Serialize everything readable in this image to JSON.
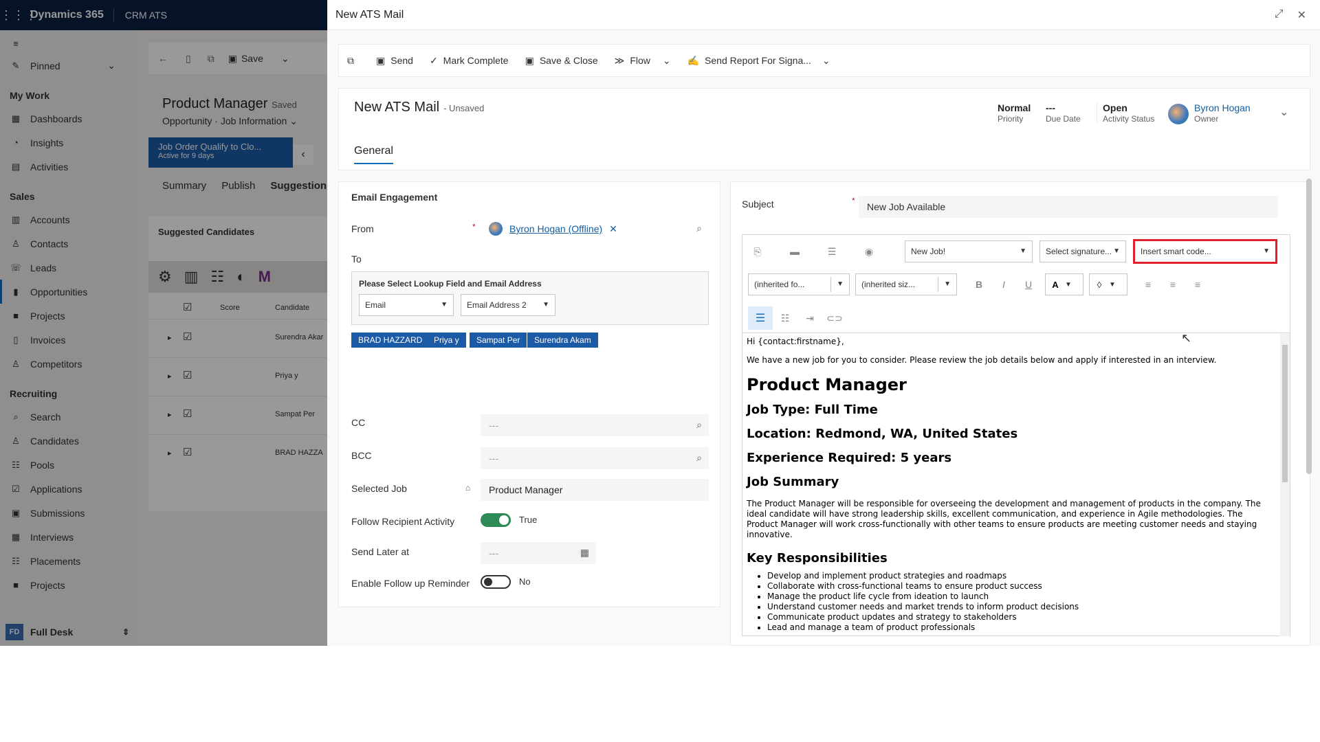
{
  "topbar": {
    "brand": "Dynamics 365",
    "app": "CRM ATS"
  },
  "sidebar": {
    "pinned": "Pinned",
    "groups": [
      {
        "label": "My Work",
        "items": [
          "Dashboards",
          "Insights",
          "Activities"
        ]
      },
      {
        "label": "Sales",
        "items": [
          "Accounts",
          "Contacts",
          "Leads",
          "Opportunities",
          "Projects",
          "Invoices",
          "Competitors"
        ]
      },
      {
        "label": "Recruiting",
        "items": [
          "Search",
          "Candidates",
          "Pools",
          "Applications",
          "Submissions",
          "Interviews",
          "Placements",
          "Projects"
        ]
      }
    ],
    "desk_badge": "FD",
    "desk": "Full Desk"
  },
  "record": {
    "save": "Save",
    "title": "Product Manager",
    "status": "Saved",
    "entity": "Opportunity",
    "form": "Job Information",
    "bpf_title": "Job Order Qualify to Clo...",
    "bpf_sub": "Active for 9 days",
    "tabs": [
      "Summary",
      "Publish",
      "Suggestion"
    ],
    "grid_title": "Suggested Candidates",
    "col_score": "Score",
    "col_candidate": "Candidate",
    "rows": [
      "Surendra Akar",
      "Priya y",
      "Sampat Per",
      "BRAD HAZZA"
    ]
  },
  "panel": {
    "title": "New ATS Mail",
    "commands": [
      "Send",
      "Mark Complete",
      "Save & Close",
      "Flow",
      "Send Report For Signa..."
    ],
    "form_title": "New ATS Mail",
    "form_status": "- Unsaved",
    "priority": {
      "value": "Normal",
      "label": "Priority"
    },
    "due": {
      "value": "---",
      "label": "Due Date"
    },
    "activity": {
      "value": "Open",
      "label": "Activity Status"
    },
    "owner": {
      "value": "Byron Hogan",
      "label": "Owner"
    },
    "tab": "General"
  },
  "email": {
    "section": "Email Engagement",
    "from_label": "From",
    "from_value": "Byron Hogan (Offline)",
    "to_label": "To",
    "lookup_title": "Please Select Lookup Field and Email Address",
    "lookup_field": "Email",
    "lookup_address": "Email Address 2",
    "chips": [
      "BRAD HAZZARD",
      "Priya y",
      "Sampat Per",
      "Surendra Akam"
    ],
    "cc_label": "CC",
    "cc_value": "---",
    "bcc_label": "BCC",
    "bcc_value": "---",
    "job_label": "Selected Job",
    "job_value": "Product Manager",
    "follow_label": "Follow Recipient Activity",
    "follow_value": "True",
    "later_label": "Send Later at",
    "later_value": "---",
    "reminder_label": "Enable Follow up Reminder",
    "reminder_value": "No"
  },
  "editor": {
    "subject_label": "Subject",
    "subject_value": "New Job Available",
    "template": "New Job!",
    "signature": "Select signature...",
    "smart_code": "Insert smart code...",
    "font": "(inherited fo...",
    "size": "(inherited siz...",
    "greeting": "Hi {contact:firstname},",
    "intro": "We have a new job for you to consider. Please review the job details below and apply if interested in an interview.",
    "heading": "Product Manager",
    "job_type": "Job Type: Full Time",
    "location": "Location: Redmond, WA, United States",
    "experience": "Experience Required: 5 years",
    "summary_h": "Job Summary",
    "summary": "The Product Manager will be responsible for overseeing the development and management of products in the company. The ideal candidate will have strong leadership skills, excellent communication, and experience in Agile methodologies. The Product Manager will work cross-functionally with other teams to ensure products are meeting customer needs and staying innovative.",
    "resp_h": "Key Responsibilities",
    "responsibilities": [
      "Develop and implement product strategies and roadmaps",
      "Collaborate with cross-functional teams to ensure product success",
      "Manage the product life cycle from ideation to launch",
      "Understand customer needs and market trends to inform product decisions",
      "Communicate product updates and strategy to stakeholders",
      "Lead and manage a team of product professionals"
    ]
  }
}
